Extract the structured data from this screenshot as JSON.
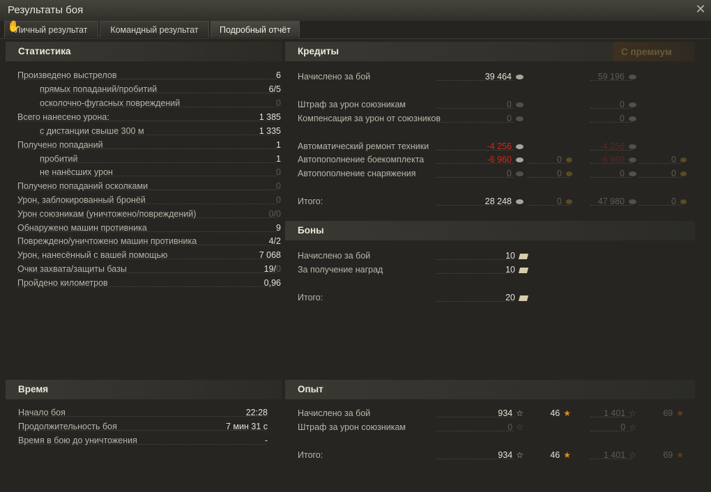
{
  "window": {
    "title": "Результаты боя",
    "close_label": "✕"
  },
  "tabs": [
    {
      "label": "Личный результат"
    },
    {
      "label": "Командный результат"
    },
    {
      "label": "Подробный отчёт"
    }
  ],
  "stats": {
    "header": "Статистика",
    "rows": [
      {
        "label": "Произведено выстрелов",
        "value": "6"
      },
      {
        "label": "прямых попаданий/пробитий",
        "value": "6/5"
      },
      {
        "label": "осколочно-фугасных повреждений",
        "value": "0"
      },
      {
        "label": "Всего нанесено урона:",
        "value": "1 385"
      },
      {
        "label": "с дистанции свыше 300 м",
        "value": "1 335"
      },
      {
        "label": "Получено попаданий",
        "value": "1"
      },
      {
        "label": "пробитий",
        "value": "1"
      },
      {
        "label": "не нанёсших урон",
        "value": "0"
      },
      {
        "label": "Получено попаданий осколками",
        "value": "0"
      },
      {
        "label": "Урон, заблокированный бронёй",
        "value": "0"
      },
      {
        "label": "Урон союзникам (уничтожено/повреждений)",
        "value": "0/0"
      },
      {
        "label": "Обнаружено машин противника",
        "value": "9"
      },
      {
        "label": "Повреждено/уничтожено машин противника",
        "value": "4/2"
      },
      {
        "label": "Урон, нанесённый с вашей помощью",
        "value": "7 068"
      },
      {
        "label": "Очки захвата/защиты базы",
        "value": "19/",
        "value2": "0"
      },
      {
        "label": "Пройдено километров",
        "value": "0,96"
      }
    ]
  },
  "time": {
    "header": "Время",
    "rows": [
      {
        "label": "Начало боя",
        "value": "22:28"
      },
      {
        "label": "Продолжительность боя",
        "value": "7 мин 31 с"
      },
      {
        "label": "Время в бою до уничтожения",
        "value": "-"
      }
    ]
  },
  "credits": {
    "header": "Кредиты",
    "premium_header": "С премиум",
    "rows": [
      {
        "label": "Начислено за бой",
        "c1": "39 464",
        "c2": "",
        "c3": "59 196",
        "c4": ""
      },
      {
        "label": "Штраф за урон союзникам",
        "c1": "0",
        "c2": "",
        "c3": "0",
        "c4": ""
      },
      {
        "label": "Компенсация за урон от союзников",
        "c1": "0",
        "c2": "",
        "c3": "0",
        "c4": ""
      },
      {
        "label": "Автоматический ремонт техники",
        "c1": "-4 256",
        "c2": "",
        "c3": "-4 256",
        "c4": ""
      },
      {
        "label": "Автопополнение боекомплекта",
        "c1": "-6 960",
        "c2": "0",
        "c3": "-6 960",
        "c4": "0"
      },
      {
        "label": "Автопополнение снаряжения",
        "c1": "0",
        "c2": "0",
        "c3": "0",
        "c4": "0"
      },
      {
        "label": "Итого:",
        "c1": "28 248",
        "c2": "0",
        "c3": "47 980",
        "c4": "0"
      }
    ]
  },
  "bonds": {
    "header": "Боны",
    "rows": [
      {
        "label": "Начислено за бой",
        "value": "10"
      },
      {
        "label": "За получение наград",
        "value": "10"
      },
      {
        "label": "Итого:",
        "value": "20"
      }
    ]
  },
  "exp": {
    "header": "Опыт",
    "rows": [
      {
        "label": "Начислено за бой",
        "c1": "934",
        "c2": "46",
        "c3": "1 401",
        "c4": "69"
      },
      {
        "label": "Штраф за урон союзникам",
        "c1": "0",
        "c2": "",
        "c3": "0",
        "c4": ""
      },
      {
        "label": "Итого:",
        "c1": "934",
        "c2": "46",
        "c3": "1 401",
        "c4": "69"
      }
    ]
  },
  "colors": {
    "penalty": "#d8241c",
    "gold": "#c79b2a",
    "free_xp": "#e28b26"
  }
}
